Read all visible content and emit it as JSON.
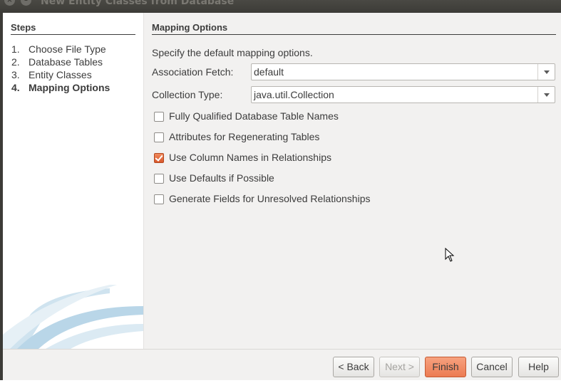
{
  "window": {
    "title": "New Entity Classes from Database"
  },
  "steps": {
    "heading": "Steps",
    "items": [
      {
        "num": "1.",
        "label": "Choose File Type"
      },
      {
        "num": "2.",
        "label": "Database Tables"
      },
      {
        "num": "3.",
        "label": "Entity Classes"
      },
      {
        "num": "4.",
        "label": "Mapping Options"
      }
    ],
    "current_index": 3
  },
  "panel": {
    "title": "Mapping Options",
    "description": "Specify the default mapping options.",
    "association_fetch": {
      "label": "Association Fetch:",
      "value": "default"
    },
    "collection_type": {
      "label": "Collection Type:",
      "value": "java.util.Collection"
    },
    "options": [
      {
        "label": "Fully Qualified Database Table Names",
        "checked": false
      },
      {
        "label": "Attributes for Regenerating Tables",
        "checked": false
      },
      {
        "label": "Use Column Names in Relationships",
        "checked": true
      },
      {
        "label": "Use Defaults if Possible",
        "checked": false
      },
      {
        "label": "Generate Fields for Unresolved Relationships",
        "checked": false
      }
    ]
  },
  "buttons": {
    "back": "< Back",
    "next": "Next >",
    "finish": "Finish",
    "cancel": "Cancel",
    "help": "Help"
  },
  "colors": {
    "accent": "#ec7b52",
    "panel_bg": "#f2f1f0",
    "titlebar": "#3c3b37"
  }
}
